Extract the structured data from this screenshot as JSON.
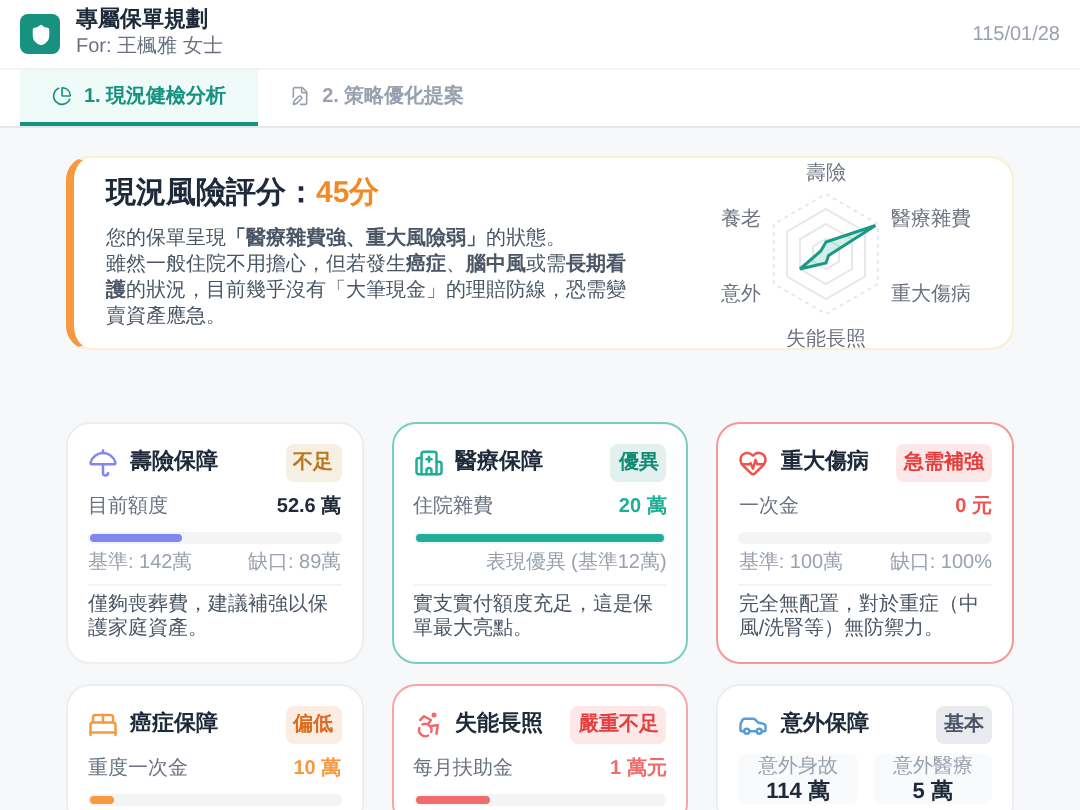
{
  "header": {
    "title": "專屬保單規劃",
    "subtitle": "For: 王楓雅 女士",
    "date": "115/01/28"
  },
  "tabs": [
    {
      "label": "1. 現況健檢分析",
      "selected": true
    },
    {
      "label": "2. 策略優化提案",
      "selected": false
    }
  ],
  "score": {
    "title": "現況風險評分：",
    "value": "45分",
    "lines": [
      "您的保單呈現**「醫療雜費強、重大風險弱」**的狀態。",
      "雖然一般住院不用擔心，但若發生**癌症**、**腦中風**或需**長期看護**的狀況，目前幾乎沒有「大筆現金」的理賠防線，恐需變賣資產應急。"
    ],
    "radar_labels": [
      "壽險",
      "醫療雜費",
      "重大傷病",
      "失能長照",
      "意外",
      "養老"
    ]
  },
  "cards": [
    {
      "kind": "bar",
      "title": "壽險保障",
      "badge": {
        "text": "不足",
        "color": "#b7791f"
      },
      "color": "#8187ee",
      "highlight": false,
      "accent_value": false,
      "label": "目前額度",
      "value": "52.6 萬",
      "level": 0.37,
      "note_left": "基準: 142萬",
      "note_right": "缺口: 89萬",
      "desc": "僅夠喪葬費，建議補強以保護家庭資產。"
    },
    {
      "kind": "bar",
      "title": "醫療保障",
      "badge": {
        "text": "優異",
        "color": "#138a72"
      },
      "color": "#1fae96",
      "highlight": true,
      "accent_value": true,
      "label": "住院雜費",
      "value": "20 萬",
      "level": 1,
      "note_right": "表現優異 (基準12萬)",
      "desc": "實支實付額度充足，這是保單最大亮點。"
    },
    {
      "kind": "bar",
      "title": "重大傷病",
      "badge": {
        "text": "急需補強",
        "color": "#e53e3e"
      },
      "color": "#ef5350",
      "highlight": true,
      "accent_value": true,
      "label": "一次金",
      "value": "0 元",
      "level": 0,
      "note_left": "基準: 100萬",
      "note_right": "缺口: 100%",
      "desc": "完全無配置，對於重症（中風/洗腎等）無防禦力。"
    },
    {
      "kind": "bar",
      "title": "癌症保障",
      "badge": {
        "text": "偏低",
        "color": "#dd6b20"
      },
      "color": "#f6993f",
      "highlight": false,
      "accent_value": true,
      "label": "重度一次金",
      "value": "10 萬",
      "level": 0.1
    },
    {
      "kind": "bar",
      "title": "失能長照",
      "badge": {
        "text": "嚴重不足",
        "color": "#e53e3e"
      },
      "color": "#f06b6b",
      "highlight": true,
      "accent_value": true,
      "label": "每月扶助金",
      "value": "1 萬元",
      "level": 0.3
    },
    {
      "kind": "stats",
      "title": "意外保障",
      "badge": {
        "text": "基本",
        "color": "#4a5568"
      },
      "color": "#5b9bd5",
      "highlight": false,
      "stats": [
        {
          "label": "意外身故",
          "value": "114 萬"
        },
        {
          "label": "意外醫療",
          "value": "5 萬"
        }
      ]
    }
  ]
}
